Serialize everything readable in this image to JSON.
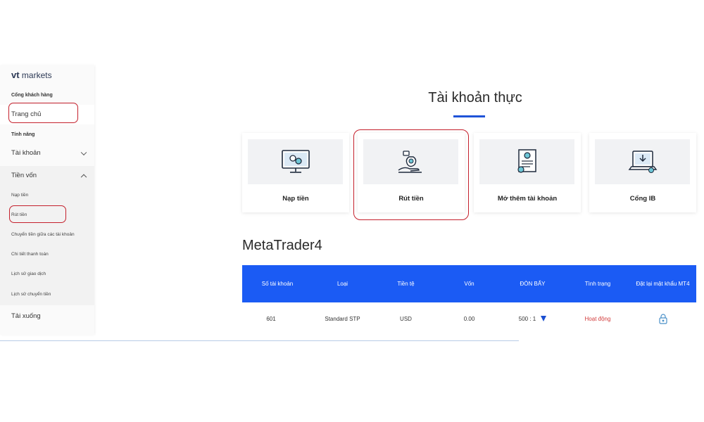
{
  "brand": {
    "logo_bold": "vt",
    "logo_rest": " markets"
  },
  "sidebar": {
    "portal_label": "Cổng khách hàng",
    "home": "Trang chủ",
    "features_label": "Tính năng",
    "account": "Tài khoản",
    "funds": "Tiền vốn",
    "deposit": "Nạp tiền",
    "withdraw": "Rút tiền",
    "transfer": "Chuyển tiền giữa các tài khoản",
    "payment_details": "Chi tiết thanh toán",
    "trade_history": "Lịch sử giao dịch",
    "transfer_history": "Lịch sử chuyển tiền",
    "downloads": "Tải xuống"
  },
  "page": {
    "title": "Tài khoản thực"
  },
  "cards": [
    {
      "label": "Nạp tiền",
      "icon": "monitor-coins-icon"
    },
    {
      "label": "Rút tiền",
      "icon": "hand-money-bag-icon"
    },
    {
      "label": "Mở thêm tài khoản",
      "icon": "certificate-document-icon"
    },
    {
      "label": "Cổng IB",
      "icon": "laptop-download-icon"
    }
  ],
  "metatrader": {
    "title": "MetaTrader4",
    "columns": [
      "Số tài khoản",
      "Loại",
      "Tiền tệ",
      "Vốn",
      "ĐÒN BẨY",
      "Tình trạng",
      "Đặt lại mật khẩu MT4"
    ],
    "rows": [
      {
        "account": "601",
        "type": "Standard STP",
        "currency": "USD",
        "equity": "0.00",
        "leverage": "500 : 1",
        "status": "Hoạt động"
      }
    ]
  },
  "colors": {
    "accent": "#1b5bf4",
    "highlight_ring": "#c4202c",
    "status_active": "#d23b3b"
  }
}
